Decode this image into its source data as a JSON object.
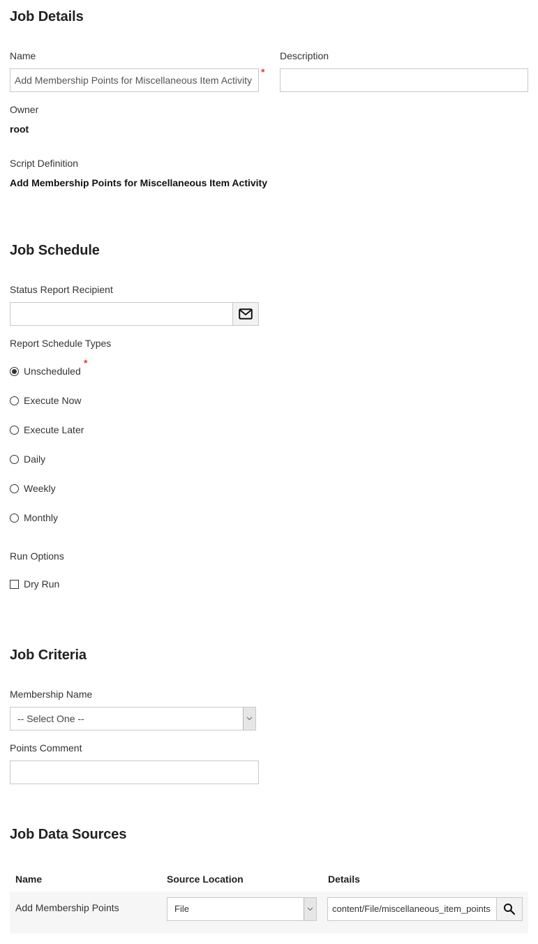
{
  "job_details": {
    "heading": "Job Details",
    "name_label": "Name",
    "name_value": "Add Membership Points for Miscellaneous Item Activity",
    "required_mark": "*",
    "description_label": "Description",
    "description_value": "",
    "owner_label": "Owner",
    "owner_value": "root",
    "script_definition_label": "Script Definition",
    "script_definition_value": "Add Membership Points for Miscellaneous Item Activity"
  },
  "job_schedule": {
    "heading": "Job Schedule",
    "recipient_label": "Status Report Recipient",
    "recipient_value": "",
    "recipient_button_icon": "mail-icon",
    "schedule_types_label": "Report Schedule Types",
    "required_mark": "*",
    "schedule_types": [
      {
        "label": "Unscheduled",
        "checked": true
      },
      {
        "label": "Execute Now",
        "checked": false
      },
      {
        "label": "Execute Later",
        "checked": false
      },
      {
        "label": "Daily",
        "checked": false
      },
      {
        "label": "Weekly",
        "checked": false
      },
      {
        "label": "Monthly",
        "checked": false
      }
    ],
    "run_options_label": "Run Options",
    "dry_run_label": "Dry Run",
    "dry_run_checked": false
  },
  "job_criteria": {
    "heading": "Job Criteria",
    "membership_name_label": "Membership Name",
    "membership_name_selected": "-- Select One --",
    "points_comment_label": "Points Comment",
    "points_comment_value": ""
  },
  "job_data_sources": {
    "heading": "Job Data Sources",
    "columns": [
      "Name",
      "Source Location",
      "Details"
    ],
    "rows": [
      {
        "name": "Add Membership Points",
        "source_location": "File",
        "details": "content/File/miscellaneous_item_points",
        "details_button_icon": "search-icon"
      }
    ]
  },
  "colors": {
    "required": "#e53935",
    "row_background": "#f6f6f6",
    "input_border": "#c8c8c8",
    "addon_background": "#f2f2f2"
  }
}
